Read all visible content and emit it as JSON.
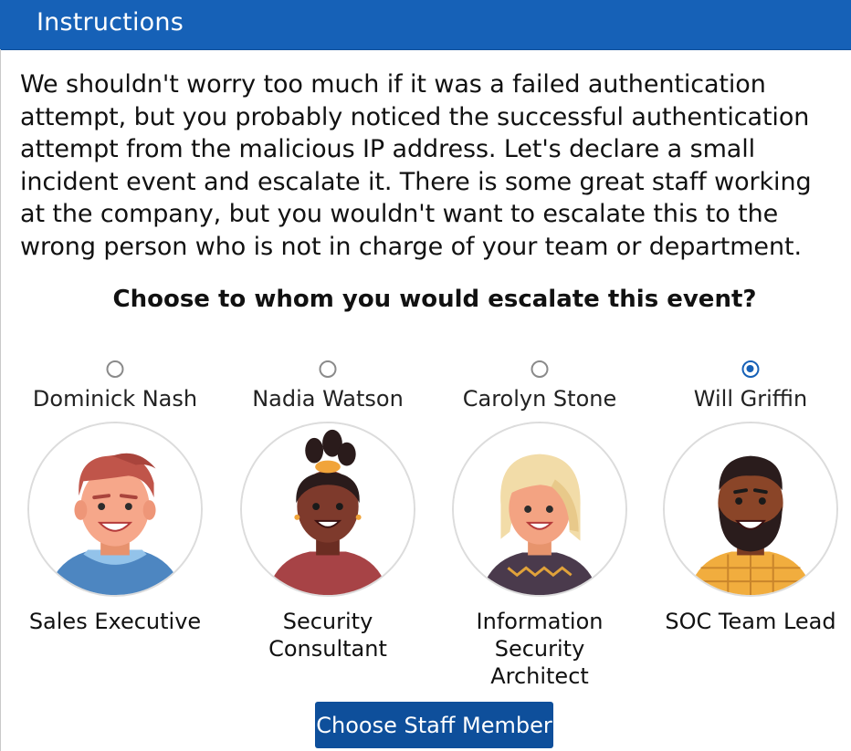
{
  "header": {
    "title": "Instructions"
  },
  "instructions": {
    "text": "We shouldn't worry too much if it was a failed authentication attempt, but you probably noticed the successful authentication attempt from the malicious IP address. Let's declare a small incident event and escalate it. There is some great staff working at the company, but you wouldn't want to escalate this to the wrong person who is not in charge of your team or department."
  },
  "question": "Choose to whom you would escalate this event?",
  "staff": [
    {
      "name": "Dominick Nash",
      "role": "Sales Executive",
      "selected": false,
      "avatar_icon": "man-avatar-icon"
    },
    {
      "name": "Nadia Watson",
      "role": "Security Consultant",
      "selected": false,
      "avatar_icon": "woman-avatar-icon"
    },
    {
      "name": "Carolyn Stone",
      "role": "Information Security Architect",
      "selected": false,
      "avatar_icon": "woman-blonde-avatar-icon"
    },
    {
      "name": "Will Griffin",
      "role": "SOC Team Lead",
      "selected": true,
      "avatar_icon": "bearded-man-avatar-icon"
    }
  ],
  "button": {
    "label": "Choose Staff Member"
  },
  "colors": {
    "header": "#1661b7",
    "button": "#0e4f9b",
    "radio_selected": "#1661b7"
  }
}
